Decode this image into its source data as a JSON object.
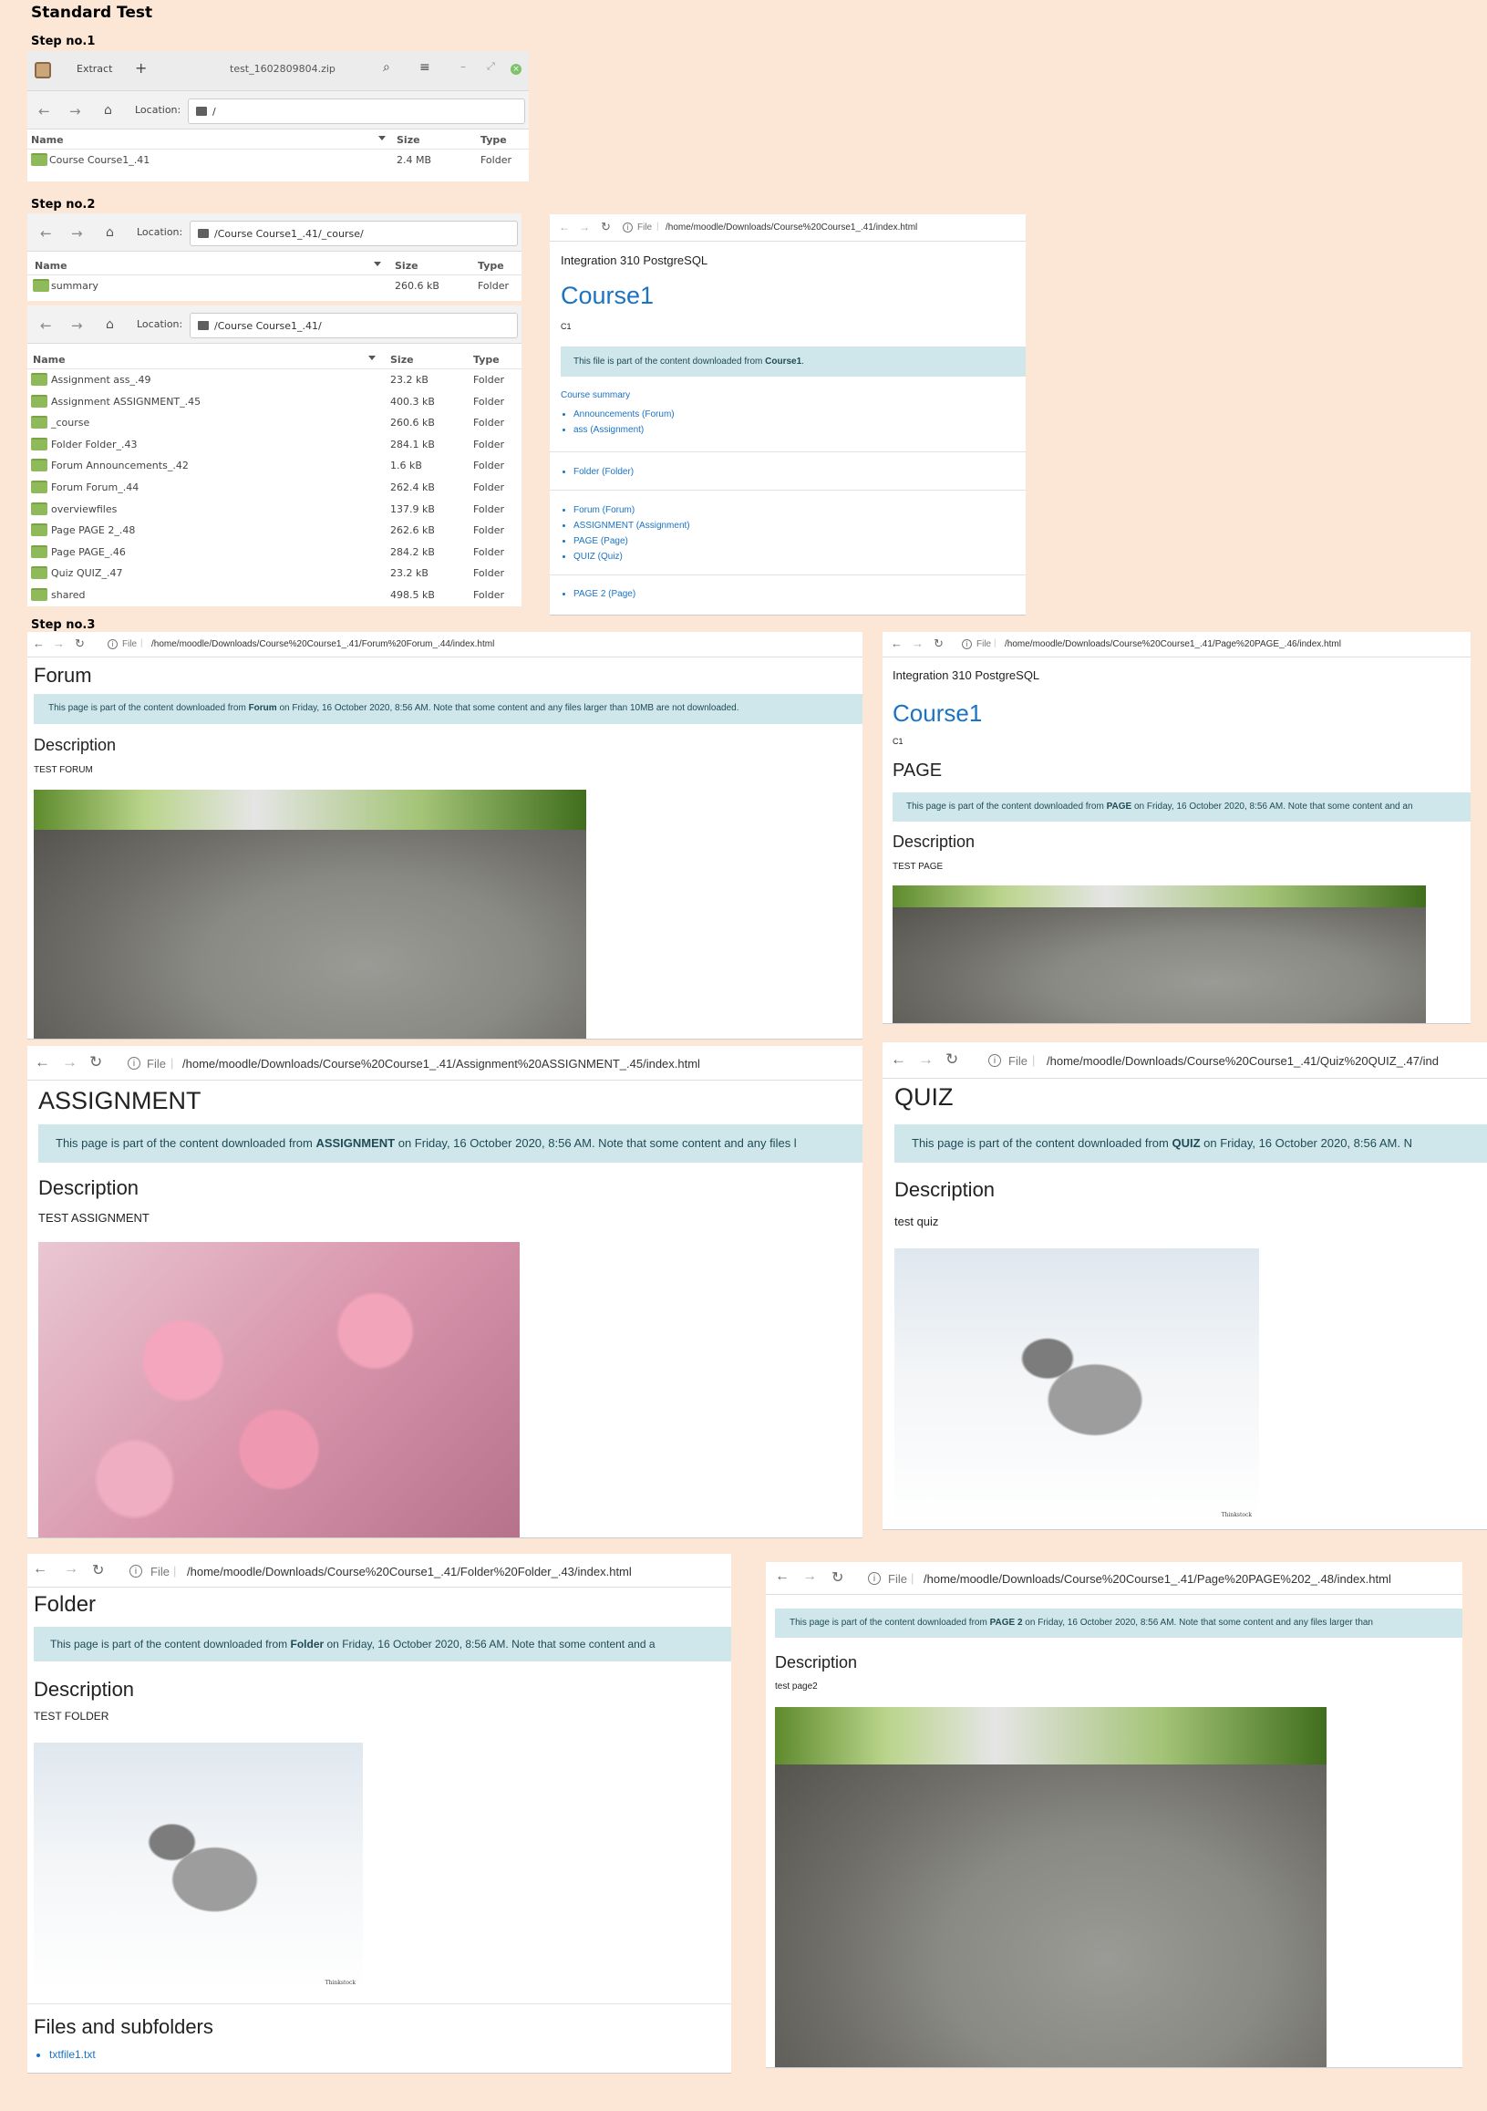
{
  "title": "Standard Test",
  "steps": [
    "Step no.1",
    "Step no.2",
    "Step no.3"
  ],
  "archive": {
    "extract_label": "Extract",
    "add_label": "+",
    "filename": "test_1602809804.zip",
    "location_label": "Location:",
    "location": "/",
    "columns": [
      "Name",
      "Size",
      "Type"
    ],
    "rows": [
      {
        "name": "Course Course1_.41",
        "size": "2.4 MB",
        "type": "Folder"
      }
    ]
  },
  "fm_course": {
    "location_label": "Location:",
    "location": "/Course Course1_.41/_course/",
    "columns": [
      "Name",
      "Size",
      "Type"
    ],
    "rows": [
      {
        "name": "summary",
        "size": "260.6 kB",
        "type": "Folder"
      }
    ]
  },
  "fm_root": {
    "location_label": "Location:",
    "location": "/Course Course1_.41/",
    "columns": [
      "Name",
      "Size",
      "Type"
    ],
    "rows": [
      {
        "name": "Assignment ass_.49",
        "size": "23.2 kB",
        "type": "Folder"
      },
      {
        "name": "Assignment ASSIGNMENT_.45",
        "size": "400.3 kB",
        "type": "Folder"
      },
      {
        "name": "_course",
        "size": "260.6 kB",
        "type": "Folder"
      },
      {
        "name": "Folder Folder_.43",
        "size": "284.1 kB",
        "type": "Folder"
      },
      {
        "name": "Forum Announcements_.42",
        "size": "1.6 kB",
        "type": "Folder"
      },
      {
        "name": "Forum Forum_.44",
        "size": "262.4 kB",
        "type": "Folder"
      },
      {
        "name": "overviewfiles",
        "size": "137.9 kB",
        "type": "Folder"
      },
      {
        "name": "Page PAGE 2_.48",
        "size": "262.6 kB",
        "type": "Folder"
      },
      {
        "name": "Page PAGE_.46",
        "size": "284.2 kB",
        "type": "Folder"
      },
      {
        "name": "Quiz QUIZ_.47",
        "size": "23.2 kB",
        "type": "Folder"
      },
      {
        "name": "shared",
        "size": "498.5 kB",
        "type": "Folder"
      }
    ]
  },
  "browser": {
    "file_label": "File",
    "info_icon": "i"
  },
  "index_page": {
    "url": "/home/moodle/Downloads/Course%20Course1_.41/index.html",
    "site": "Integration 310 PostgreSQL",
    "course": "Course1",
    "short": "C1",
    "alert_pre": "This file is part of the content downloaded from ",
    "alert_bold": "Course1",
    "alert_post": ".",
    "summary": "Course summary",
    "group1": [
      "Announcements (Forum)",
      "ass (Assignment)"
    ],
    "group2": [
      "Folder (Folder)"
    ],
    "group3": [
      "Forum (Forum)",
      "ASSIGNMENT (Assignment)",
      "PAGE (Page)",
      "QUIZ (Quiz)"
    ],
    "group4": [
      "PAGE 2 (Page)"
    ]
  },
  "forum_page": {
    "url": "/home/moodle/Downloads/Course%20Course1_.41/Forum%20Forum_.44/index.html",
    "heading": "Forum",
    "alert_pre": "This page is part of the content downloaded from ",
    "alert_bold": "Forum",
    "alert_post": " on Friday, 16 October 2020, 8:56 AM. Note that some content and any files larger than 10MB are not downloaded.",
    "desc_heading": "Description",
    "desc": "TEST FORUM"
  },
  "page_page": {
    "url": "/home/moodle/Downloads/Course%20Course1_.41/Page%20PAGE_.46/index.html",
    "site": "Integration 310 PostgreSQL",
    "course": "Course1",
    "short": "C1",
    "heading": "PAGE",
    "alert_pre": "This page is part of the content downloaded from ",
    "alert_bold": "PAGE",
    "alert_post": " on Friday, 16 October 2020, 8:56 AM. Note that some content and an",
    "desc_heading": "Description",
    "desc": "TEST PAGE"
  },
  "assignment_page": {
    "url": "/home/moodle/Downloads/Course%20Course1_.41/Assignment%20ASSIGNMENT_.45/index.html",
    "heading": "ASSIGNMENT",
    "alert_pre": "This page is part of the content downloaded from ",
    "alert_bold": "ASSIGNMENT",
    "alert_post": " on Friday, 16 October 2020, 8:56 AM. Note that some content and any files l",
    "desc_heading": "Description",
    "desc": "TEST ASSIGNMENT"
  },
  "quiz_page": {
    "url": "/home/moodle/Downloads/Course%20Course1_.41/Quiz%20QUIZ_.47/ind",
    "heading": "QUIZ",
    "alert_pre": "This page is part of the content downloaded from ",
    "alert_bold": "QUIZ",
    "alert_post": " on Friday, 16 October 2020, 8:56 AM. N",
    "desc_heading": "Description",
    "desc": "test quiz",
    "watermark": "Thinkstock"
  },
  "folder_page": {
    "url": "/home/moodle/Downloads/Course%20Course1_.41/Folder%20Folder_.43/index.html",
    "heading": "Folder",
    "alert_pre": "This page is part of the content downloaded from ",
    "alert_bold": "Folder",
    "alert_post": " on Friday, 16 October 2020, 8:56 AM. Note that some content and a",
    "desc_heading": "Description",
    "desc": "TEST FOLDER",
    "watermark": "Thinkstock",
    "files_heading": "Files and subfolders",
    "file": "txtfile1.txt"
  },
  "page2_page": {
    "url": "/home/moodle/Downloads/Course%20Course1_.41/Page%20PAGE%202_.48/index.html",
    "alert_pre": "This page is part of the content downloaded from ",
    "alert_bold": "PAGE 2",
    "alert_post": " on Friday, 16 October 2020, 8:56 AM. Note that some content and any files larger than",
    "desc_heading": "Description",
    "desc": "test page2"
  }
}
